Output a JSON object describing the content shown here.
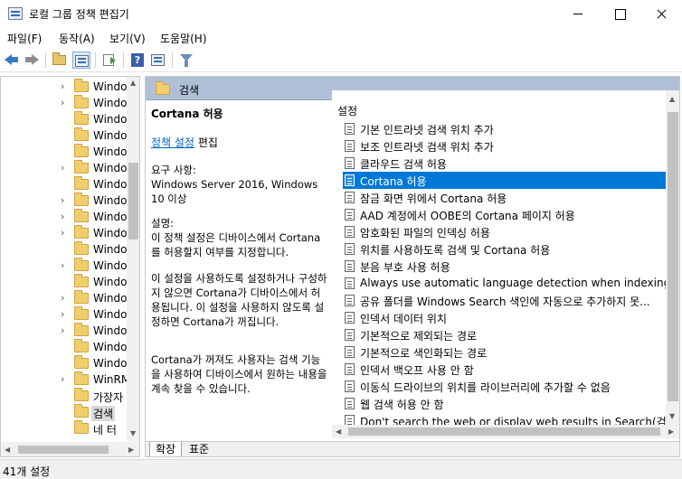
{
  "window": {
    "title": "로컬 그룹 정책 편집기"
  },
  "menu": [
    "파일(F)",
    "동작(A)",
    "보기(V)",
    "도움말(H)"
  ],
  "toolbar": {
    "icons": [
      "back-arrow-icon",
      "forward-arrow-icon",
      "up-folder-icon",
      "show-hide-tree-icon",
      "export-list-icon",
      "help-icon",
      "properties-icon",
      "filter-icon"
    ]
  },
  "tree": {
    "items": [
      {
        "label": "Windo",
        "expandable": true
      },
      {
        "label": "Windo",
        "expandable": true
      },
      {
        "label": "Windo",
        "expandable": false
      },
      {
        "label": "Windo",
        "expandable": false
      },
      {
        "label": "Windo",
        "expandable": false
      },
      {
        "label": "Windo",
        "expandable": true
      },
      {
        "label": "Windo",
        "expandable": false
      },
      {
        "label": "Windo",
        "expandable": true
      },
      {
        "label": "Windo",
        "expandable": true
      },
      {
        "label": "Windo",
        "expandable": true
      },
      {
        "label": "Windo",
        "expandable": false
      },
      {
        "label": "Windo",
        "expandable": true
      },
      {
        "label": "Windo",
        "expandable": false
      },
      {
        "label": "Windo",
        "expandable": true
      },
      {
        "label": "Windo",
        "expandable": true
      },
      {
        "label": "Windo",
        "expandable": true
      },
      {
        "label": "Windo",
        "expandable": false
      },
      {
        "label": "Windo",
        "expandable": false
      },
      {
        "label": "WinRM",
        "expandable": true
      },
      {
        "label": "가장자",
        "expandable": false
      },
      {
        "label": "검색",
        "expandable": false,
        "selected": true
      },
      {
        "label": "네 터",
        "expandable": false
      }
    ]
  },
  "header": {
    "title": "검색"
  },
  "description": {
    "policy_name": "Cortana 허용",
    "edit_link": "정책 설정",
    "edit_suffix": "편집",
    "requirements_label": "요구 사항:",
    "requirements_text": "Windows Server 2016, Windows 10 이상",
    "desc_label": "설명:",
    "desc_p1": "이 정책 설정은 디바이스에서 Cortana를 허용할지 여부를 지정합니다.",
    "desc_p2": "이 설정을 사용하도록 설정하거나 구성하지 않으면 Cortana가 디바이스에서 허용됩니다. 이 설정을 사용하지 않도록 설정하면 Cortana가 꺼집니다.",
    "desc_p3": "Cortana가 꺼져도 사용자는 검색 기능을 사용하여 디바이스에서 원하는 내용을 계속 찾을 수 있습니다."
  },
  "list": {
    "column_header": "설정",
    "selected_index": 3,
    "rows": [
      "기본 인트라넷 검색 위치 추가",
      "보조 인트라넷 검색 위치 추가",
      "클라우드 검색 허용",
      "Cortana 허용",
      "잠금 화면 위에서 Cortana 허용",
      "AAD 계정에서 OOBE의 Cortana 페이지 허용",
      "암호화된 파일의 인덱싱 허용",
      "위치를 사용하도록 검색 및 Cortana 허용",
      "분음 부호 사용 허용",
      "Always use automatic language detection when indexing c...",
      "공유 폴더를 Windows Search 색인에 자동으로 추가하지 못...",
      "인덱서 데이터 위치",
      "기본적으로 제외되는 경로",
      "기본적으로 색인화되는 경로",
      "인덱서 백오프 사용 안 함",
      "이동식 드라이브의 위치를 라이브러리에 추가할 수 없음",
      "웹 검색 허용 안 함",
      "Don't search the web or display web results in Search(검색"
    ]
  },
  "tabs": {
    "extended": "확장",
    "standard": "표준"
  },
  "status": {
    "text": "41개 설정"
  },
  "colors": {
    "selection": "#0078d7",
    "header_bg": "#afc0d6",
    "link": "#0066cc"
  }
}
